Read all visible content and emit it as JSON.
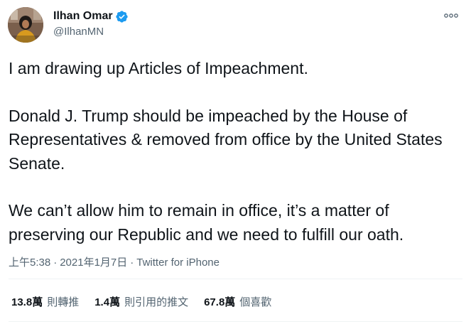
{
  "user": {
    "display_name": "Ilhan Omar",
    "handle": "@IlhanMN",
    "verified": true,
    "verified_color": "#1d9bf0"
  },
  "tweet": {
    "paragraphs": [
      "I am drawing up Articles of Impeachment.",
      "Donald J. Trump should be impeached by the House of Representatives & removed from office by the United States Senate.",
      "We can’t allow him to remain in office, it’s a matter of preserving our Republic and we need to fulfill our oath."
    ],
    "time": "上午5:38",
    "separator": "·",
    "date": "2021年1月7日",
    "source": "Twitter for iPhone"
  },
  "stats": {
    "retweets_count": "13.8萬",
    "retweets_label": "則轉推",
    "quotes_count": "1.4萬",
    "quotes_label": "則引用的推文",
    "likes_count": "67.8萬",
    "likes_label": "個喜歡"
  },
  "icons": {
    "more": "more-dots-icon",
    "verified": "verified-badge-icon"
  },
  "colors": {
    "text": "#0f1419",
    "secondary": "#536471",
    "divider": "#eff3f4"
  }
}
